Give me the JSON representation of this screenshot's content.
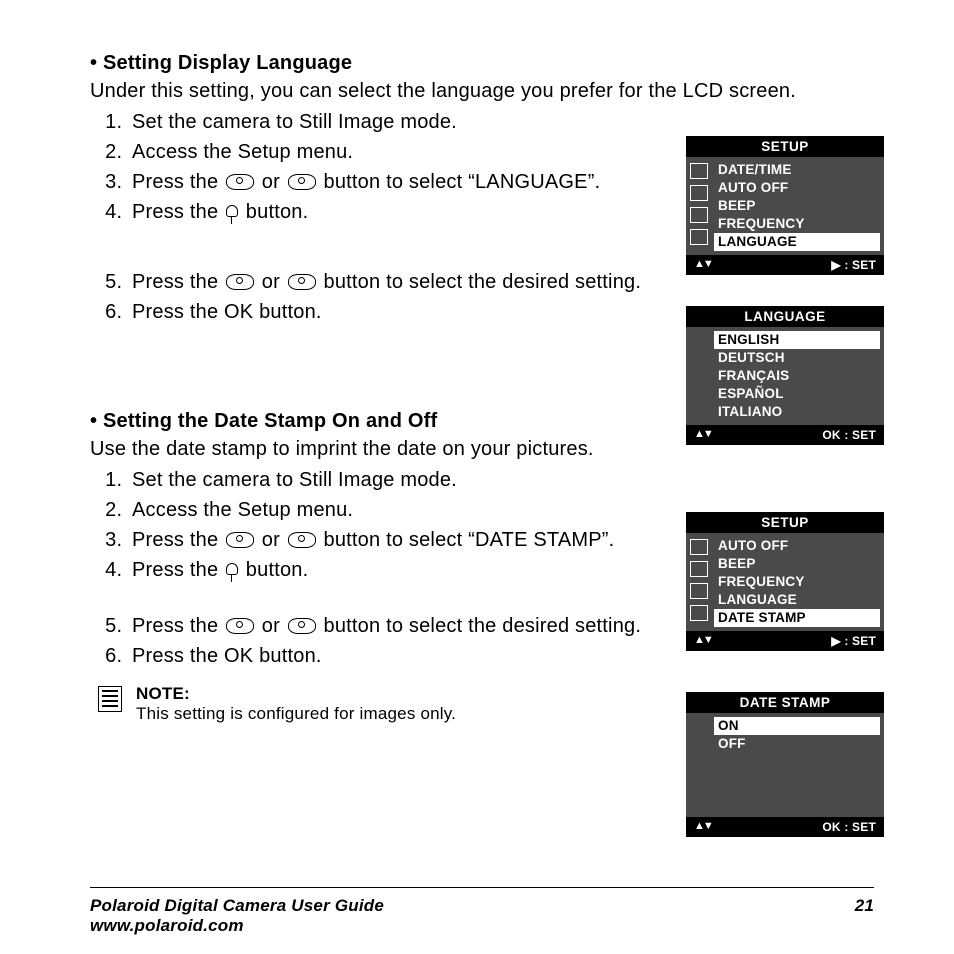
{
  "section1": {
    "heading": "• Setting Display Language",
    "intro": "Under this setting, you can select the language you prefer for the LCD screen.",
    "steps": {
      "s1": "Set the camera to Still Image mode.",
      "s2": "Access the Setup menu.",
      "s3a": "Press the ",
      "s3b": " or ",
      "s3c": " button to select “LANGUAGE”.",
      "s4a": "Press the ",
      "s4b": " button.",
      "s5a": "Press the ",
      "s5b": " or ",
      "s5c": " button to select the desired setting.",
      "s6a": "Press the ",
      "s6ok": "OK",
      "s6b": " button."
    }
  },
  "section2": {
    "heading": "• Setting the Date Stamp On and Off",
    "intro": "Use the date stamp to imprint the date on your pictures.",
    "steps": {
      "s1": "Set the camera to Still Image mode.",
      "s2": "Access the Setup menu.",
      "s3a": "Press the ",
      "s3b": " or ",
      "s3c": " button to select “DATE STAMP”.",
      "s4a": "Press the ",
      "s4b": " button.",
      "s5a": "Press the ",
      "s5b": " or ",
      "s5c": " button to select the desired setting.",
      "s6a": "Press the ",
      "s6ok": "OK",
      "s6b": " button."
    },
    "note_head": "NOTE:",
    "note_body": "This setting is configured for images only."
  },
  "lcd1": {
    "title": "SETUP",
    "items": [
      "DATE/TIME",
      "AUTO OFF",
      "BEEP",
      "FREQUENCY",
      "LANGUAGE"
    ],
    "selected": 4,
    "foot_left": "▲▼",
    "foot_right": "▶ :  SET"
  },
  "lcd2": {
    "title": "LANGUAGE",
    "items": [
      "ENGLISH",
      "DEUTSCH",
      "FRANÇAIS",
      "ESPAÑOL",
      "ITALIANO"
    ],
    "selected": 0,
    "foot_left": "▲▼",
    "foot_right": "OK :  SET"
  },
  "lcd3": {
    "title": "SETUP",
    "items": [
      "AUTO OFF",
      "BEEP",
      "FREQUENCY",
      "LANGUAGE",
      "DATE STAMP"
    ],
    "selected": 4,
    "foot_left": "▲▼",
    "foot_right": "▶ :  SET"
  },
  "lcd4": {
    "title": "DATE STAMP",
    "items": [
      "ON",
      "OFF"
    ],
    "selected": 0,
    "foot_left": "▲▼",
    "foot_right": "OK :  SET"
  },
  "footer": {
    "title": "Polaroid Digital Camera User Guide",
    "url": "www.polaroid.com",
    "page": "21"
  }
}
